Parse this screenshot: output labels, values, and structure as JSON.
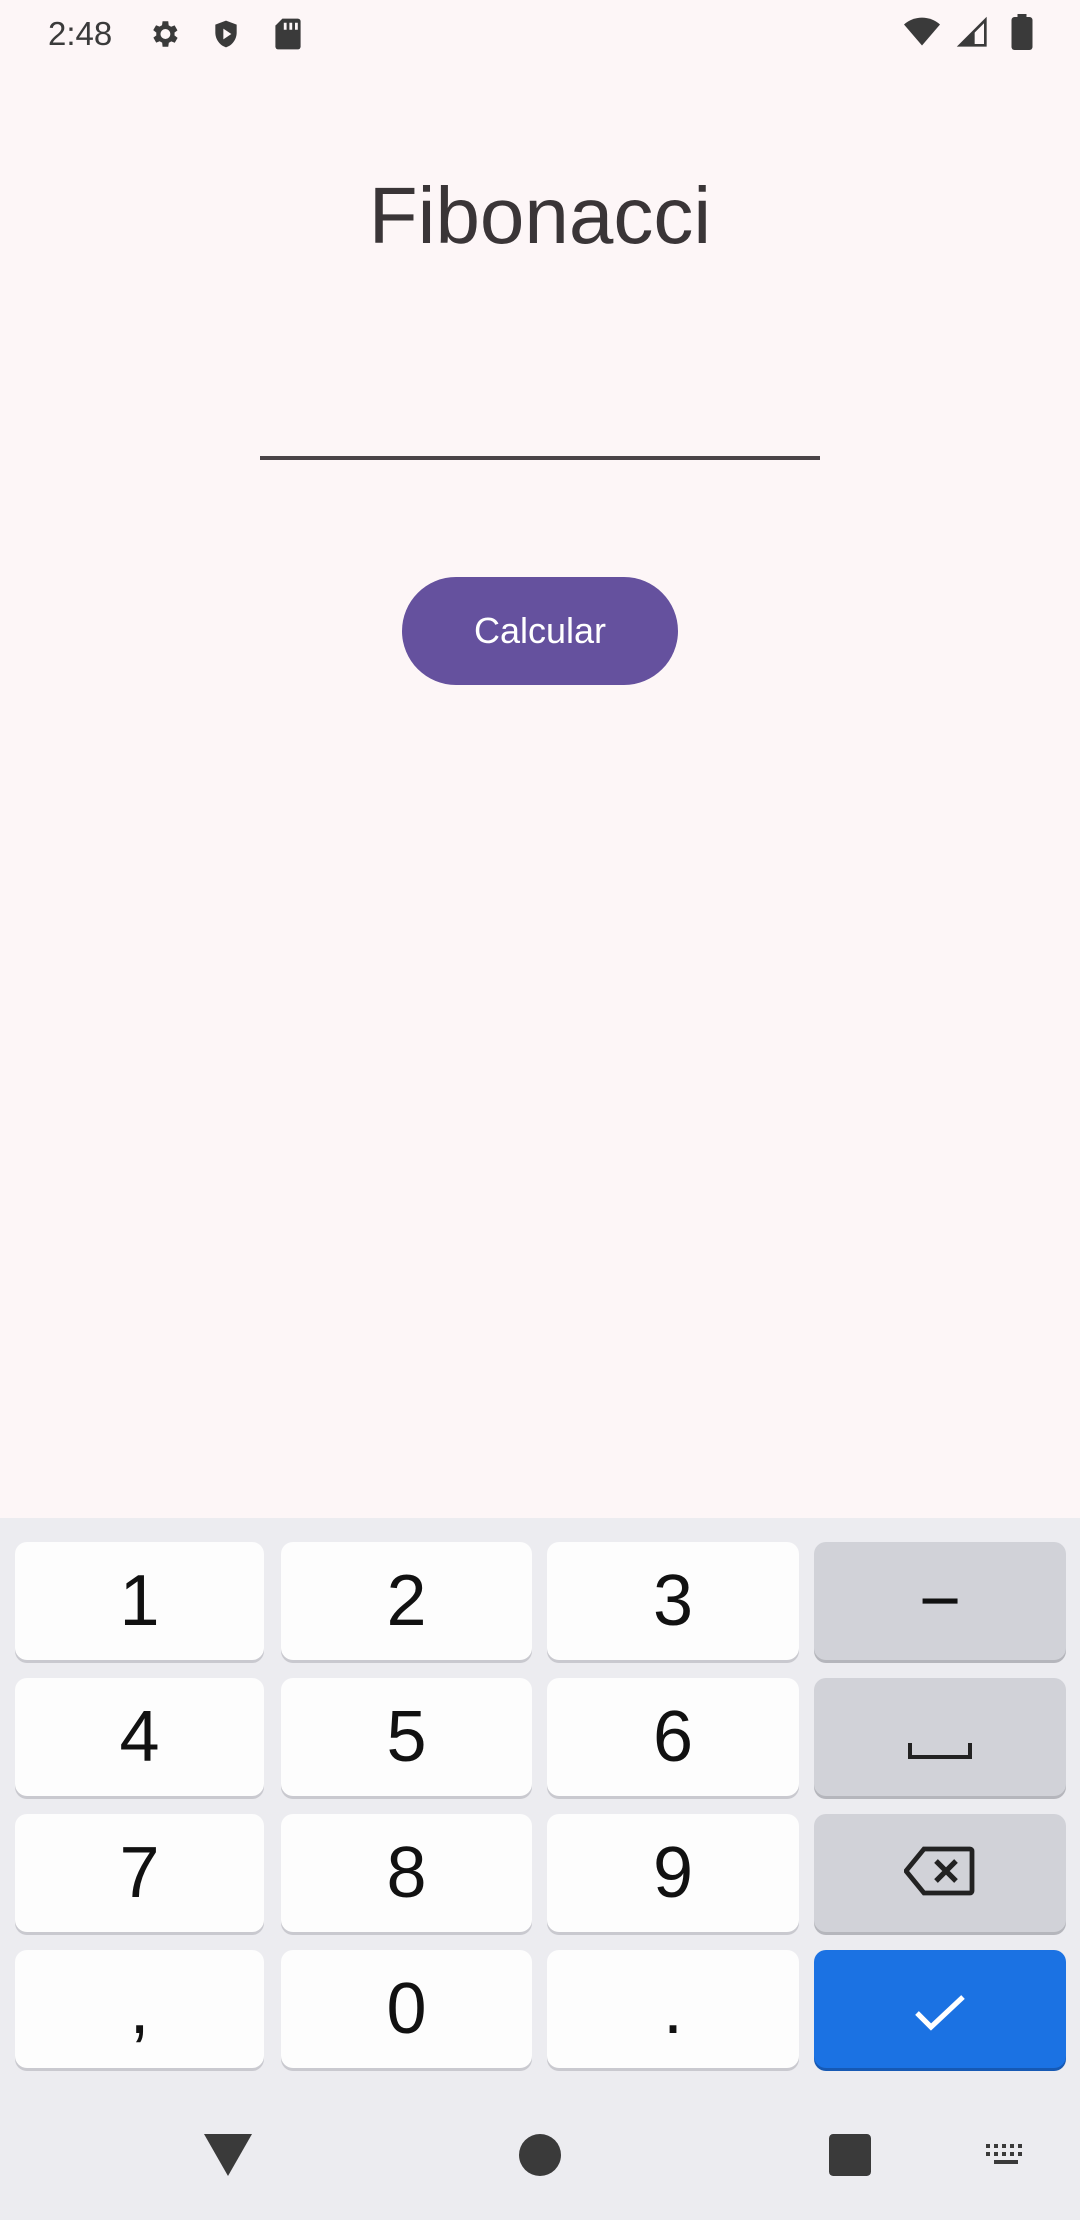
{
  "status_bar": {
    "time": "2:48",
    "left_icons": [
      "gear-icon",
      "shield-play-icon",
      "sd-card-icon"
    ],
    "right_icons": [
      "wifi-icon",
      "signal-icon",
      "battery-icon"
    ]
  },
  "app": {
    "title": "Fibonacci",
    "input": {
      "value": "",
      "placeholder": ""
    },
    "button_label": "Calcular"
  },
  "keyboard": {
    "rows": [
      [
        "1",
        "2",
        "3",
        "−"
      ],
      [
        "4",
        "5",
        "6",
        "space-icon"
      ],
      [
        "7",
        "8",
        "9",
        "backspace-icon"
      ],
      [
        ",",
        "0",
        ".",
        "check-icon"
      ]
    ]
  },
  "nav_bar": {
    "buttons": [
      "back-icon",
      "home-icon",
      "recents-icon",
      "keyboard-switch-icon"
    ]
  },
  "colors": {
    "background": "#fdf6f7",
    "button": "#65519e",
    "enter_key": "#1b72e3",
    "func_key": "#d1d2d8"
  }
}
